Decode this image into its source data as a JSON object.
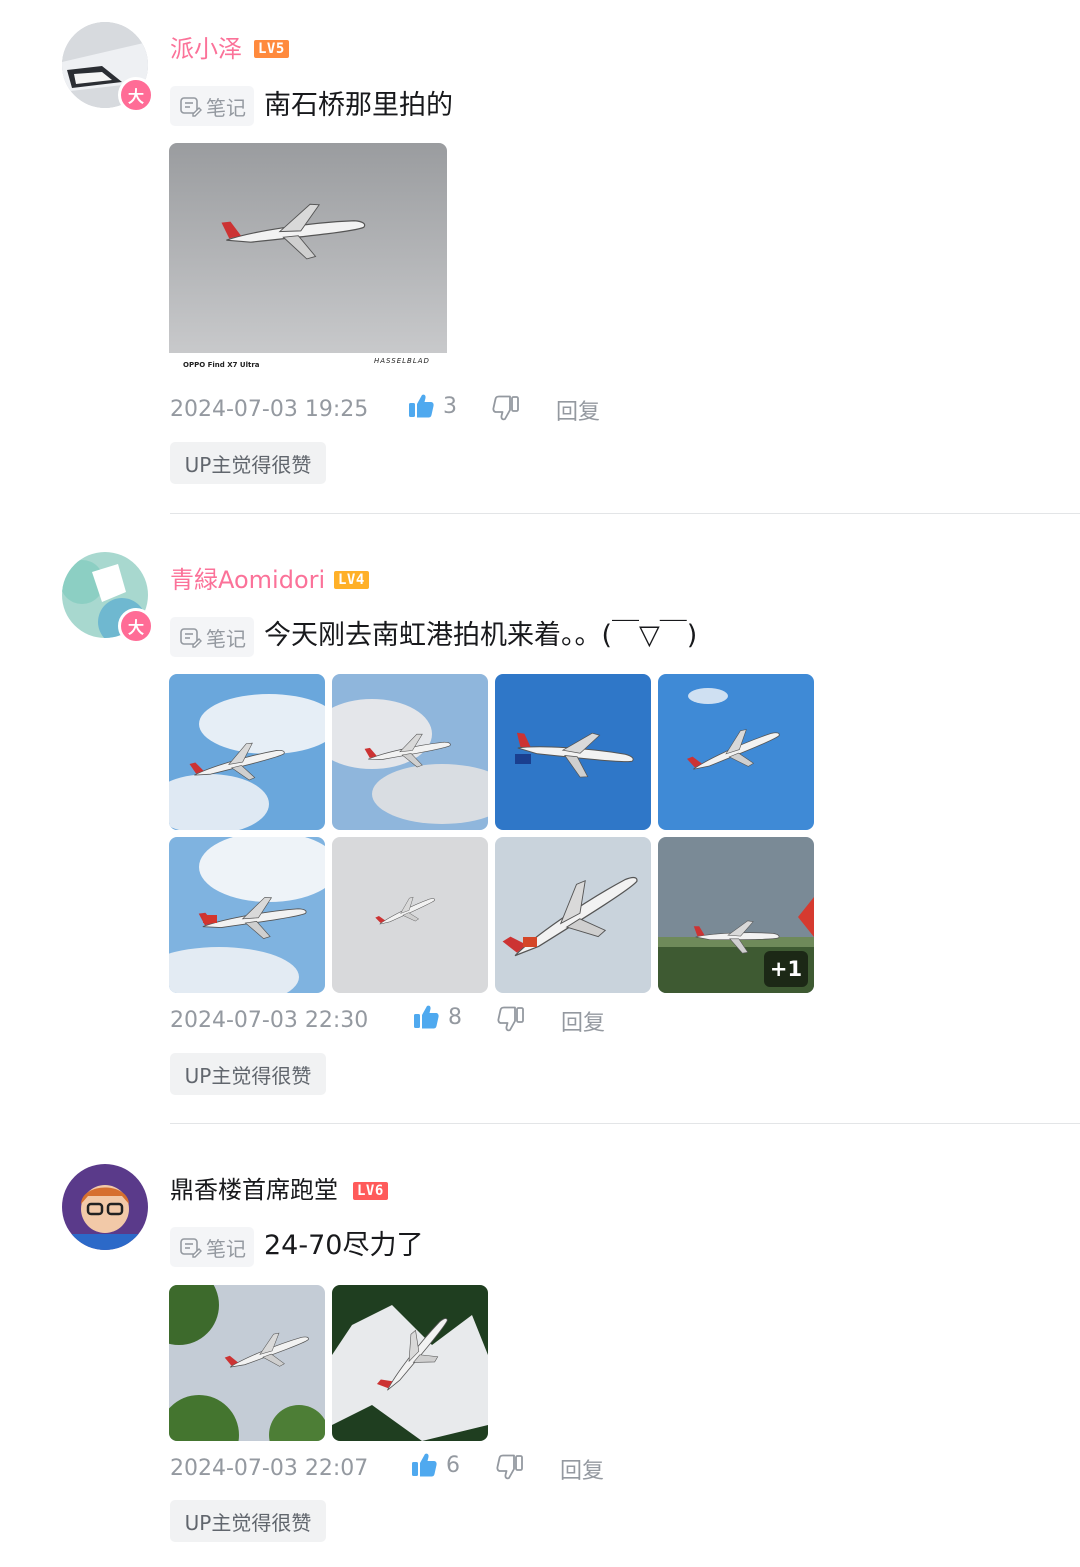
{
  "comments": [
    {
      "username": "派小泽",
      "level": "LV5",
      "username_color": "#fb7299",
      "level_color": "#ff8a3d",
      "badge": "大",
      "tag": "笔记",
      "text": "南石桥那里拍的",
      "images": [
        {
          "desc": "plane-photo",
          "caption_left": "OPPO Find X7 Ultra",
          "caption_right": "HASSELBLAD"
        }
      ],
      "timestamp": "2024-07-03 19:25",
      "likes": "3",
      "reply_label": "回复",
      "up_label": "UP主觉得很赞"
    },
    {
      "username": "青緑Aomidori",
      "level": "LV4",
      "username_color": "#fb7299",
      "level_color": "#ffb027",
      "badge": "大",
      "tag": "笔记",
      "text": "今天刚去南虹港拍机来着。。(￣▽￣)",
      "images_more": "+1",
      "timestamp": "2024-07-03 22:30",
      "likes": "8",
      "reply_label": "回复",
      "up_label": "UP主觉得很赞"
    },
    {
      "username": "鼎香楼首席跑堂",
      "level": "LV6",
      "username_color": "#18191c",
      "level_color": "#ff5a5a",
      "tag": "笔记",
      "text": "24-70尽力了",
      "timestamp": "2024-07-03 22:07",
      "likes": "6",
      "reply_label": "回复",
      "up_label": "UP主觉得很赞"
    }
  ],
  "icons": {
    "like": "thumbs-up-icon",
    "dislike": "thumbs-down-icon",
    "note": "note-icon"
  },
  "accent": "#fb7299"
}
